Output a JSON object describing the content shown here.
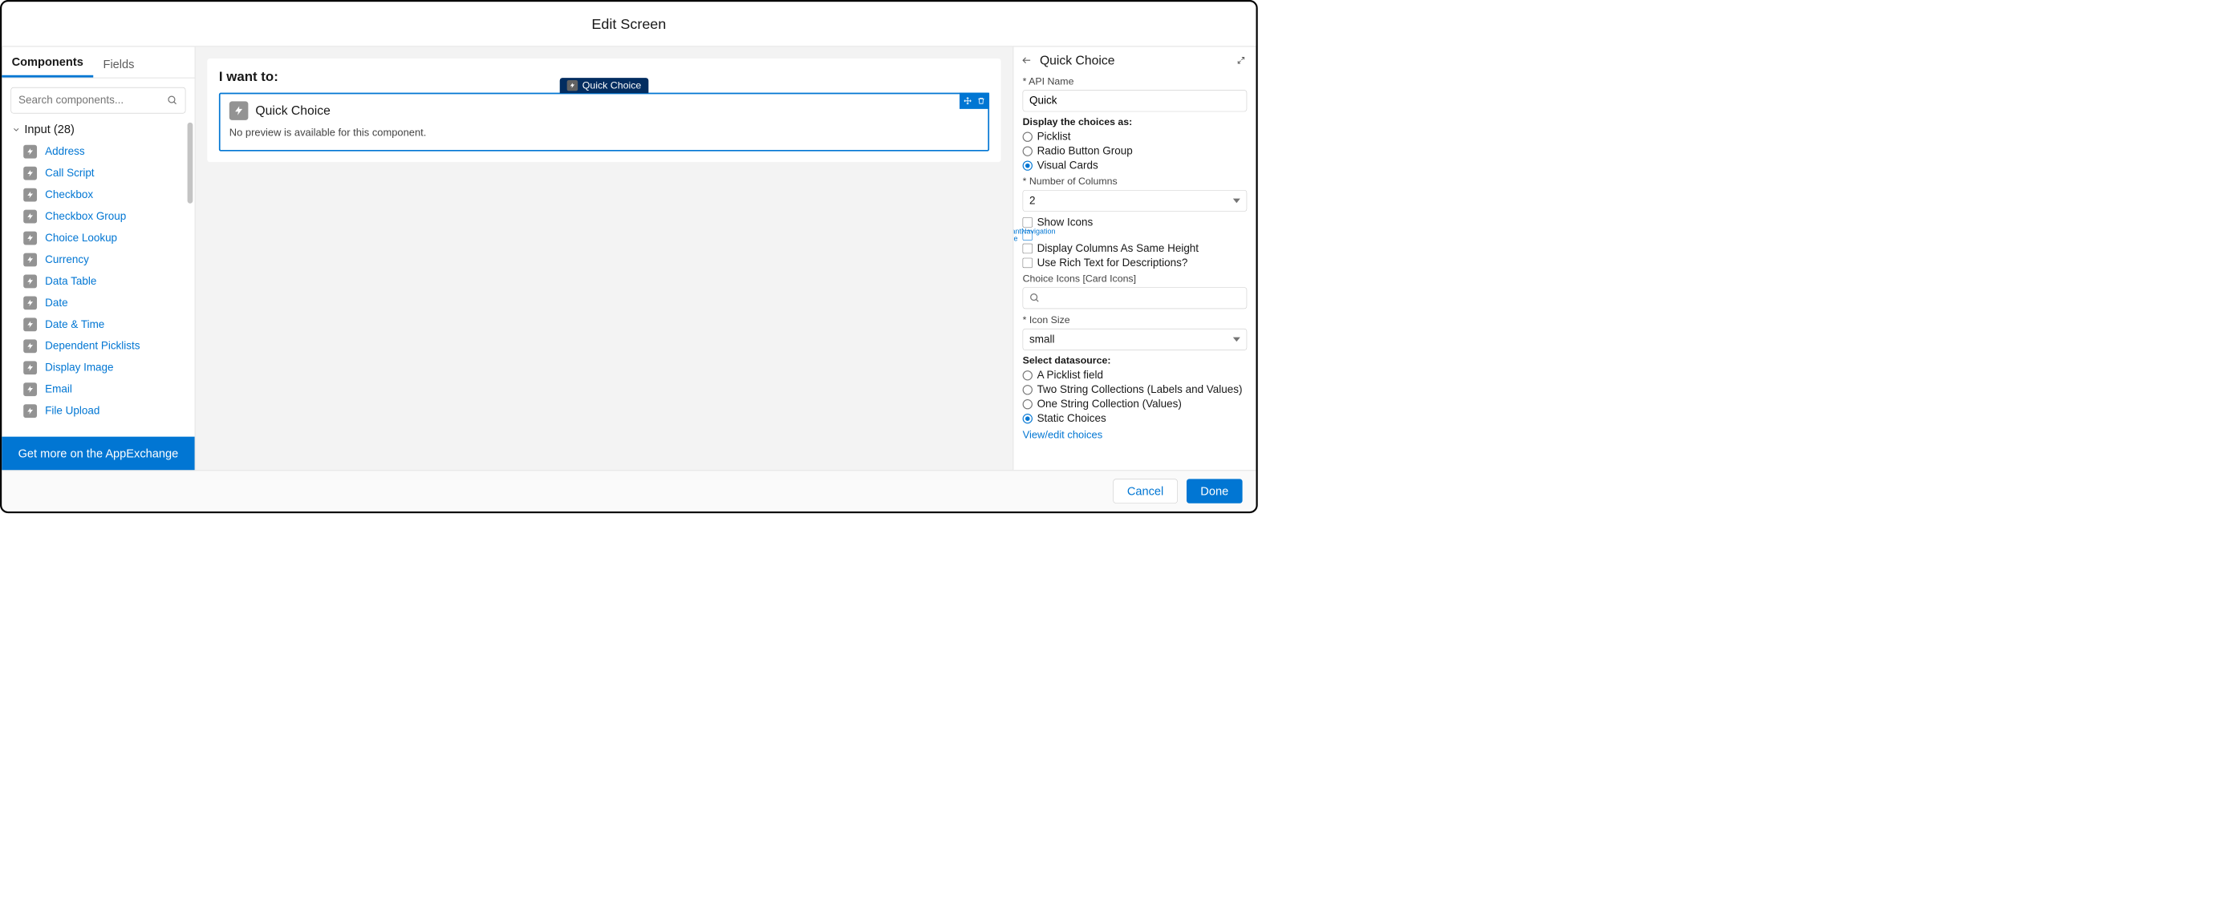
{
  "modal": {
    "title": "Edit Screen"
  },
  "palette": {
    "tabs": {
      "components": "Components",
      "fields": "Fields"
    },
    "search_placeholder": "Search components...",
    "group": {
      "label": "Input (28)"
    },
    "items": [
      "Address",
      "Call Script",
      "Checkbox",
      "Checkbox Group",
      "Choice Lookup",
      "Currency",
      "Data Table",
      "Date",
      "Date & Time",
      "Dependent Picklists",
      "Display Image",
      "Email",
      "File Upload"
    ],
    "footer": "Get more on the AppExchange"
  },
  "canvas": {
    "heading": "I want to:",
    "selected": {
      "tag_label": "Quick Choice",
      "name": "Quick Choice",
      "no_preview": "No preview is available for this component."
    }
  },
  "props": {
    "title": "Quick Choice",
    "api_name_label": "API Name",
    "api_name_value": "Quick",
    "display_as_label": "Display the choices as:",
    "display_as_options": [
      "Picklist",
      "Radio Button Group",
      "Visual Cards"
    ],
    "display_as_selected": "Visual Cards",
    "num_columns_label": "Number of Columns",
    "num_columns_value": "2",
    "checkboxes": [
      {
        "label": "Show Icons",
        "checked": false
      },
      {
        "label": "InstantNavigation Mode",
        "checked": true
      },
      {
        "label": "Display Columns As Same Height",
        "checked": false
      },
      {
        "label": "Use Rich Text for Descriptions?",
        "checked": false
      }
    ],
    "choice_icons_label": "Choice Icons [Card Icons]",
    "icon_size_label": "Icon Size",
    "icon_size_value": "small",
    "datasource_label": "Select datasource:",
    "datasource_options": [
      "A Picklist field",
      "Two String Collections (Labels and Values)",
      "One String Collection (Values)",
      "Static Choices"
    ],
    "datasource_selected": "Static Choices",
    "view_edit_link": "View/edit choices"
  },
  "footer": {
    "cancel": "Cancel",
    "done": "Done"
  }
}
